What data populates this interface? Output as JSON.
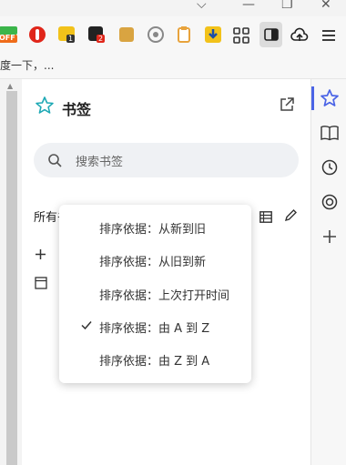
{
  "extensions": {
    "off_badge": "OFF",
    "badge_1": "1",
    "badge_2": "2"
  },
  "bookmarks_bar": {
    "text": "度一下，..."
  },
  "panel": {
    "title": "书签",
    "search_placeholder": "搜索书签",
    "all_label": "所有书"
  },
  "sort_menu": {
    "items": [
      {
        "label": "排序依据：从新到旧",
        "checked": false
      },
      {
        "label": "排序依据：从旧到新",
        "checked": false
      },
      {
        "label": "排序依据：上次打开时间",
        "checked": false
      },
      {
        "label": "排序依据：由 A 到 Z",
        "checked": true
      },
      {
        "label": "排序依据：由 Z 到 A",
        "checked": false
      }
    ]
  },
  "colors": {
    "accent": "#4b64e6",
    "star_teal": "#1fa9b5"
  }
}
